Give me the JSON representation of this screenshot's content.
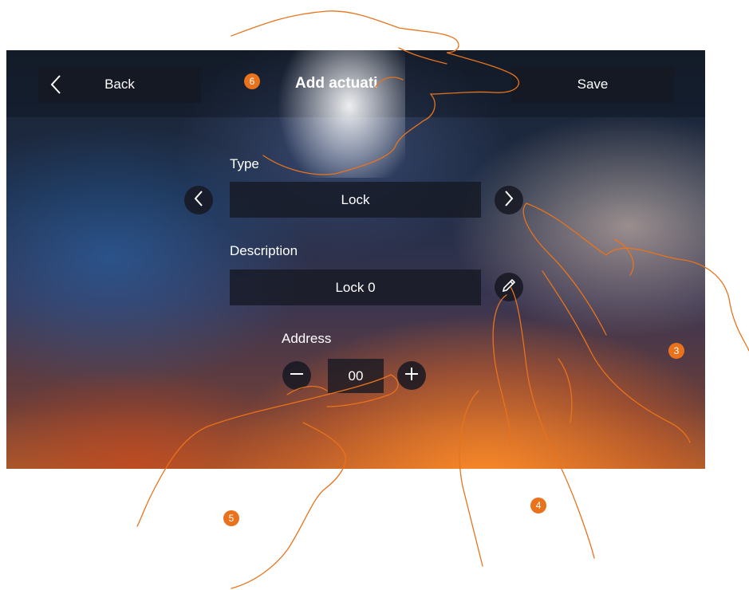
{
  "header": {
    "back_label": "Back",
    "title": "Add actuati",
    "save_label": "Save"
  },
  "form": {
    "type": {
      "label": "Type",
      "value": "Lock"
    },
    "description": {
      "label": "Description",
      "value": "Lock 0"
    },
    "address": {
      "label": "Address",
      "value": "00"
    }
  },
  "callouts": [
    "6",
    "3",
    "4",
    "5"
  ],
  "icons": [
    "back-chevron-icon",
    "chevron-left-icon",
    "chevron-right-icon",
    "pencil-icon",
    "minus-icon",
    "plus-icon"
  ],
  "colors": {
    "callout": "#e8731c",
    "panel": "#16182299"
  }
}
